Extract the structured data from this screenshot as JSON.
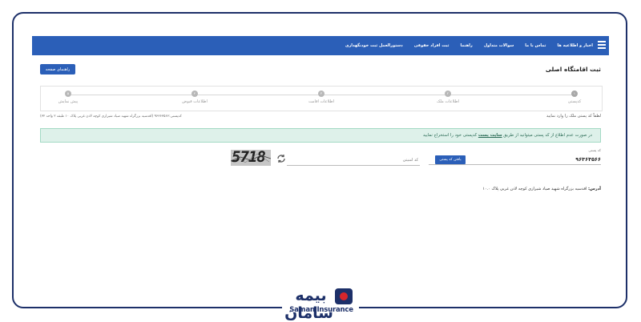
{
  "brand": {
    "name_fa": "بیمه سامان",
    "name_en": "Saman Insurance",
    "primary_color": "#1d3069",
    "accent_color": "#d6262c"
  },
  "navbar": {
    "color": "#2b5fb8",
    "menu_icon": "hamburger-menu-icon",
    "items": [
      "اخبار و اطلاعیه ها",
      "تماس با ما",
      "سوالات متداول",
      "راهنما",
      "ثبت افراد حقوقی",
      "دستورالعمل ثبت خودنگهداری"
    ]
  },
  "page": {
    "title": "ثبت اقامتگاه اصلی",
    "guide_button": "راهنمای صفحه"
  },
  "stepper": {
    "steps": [
      {
        "number": "۱",
        "label": "کدپستی"
      },
      {
        "number": "۲",
        "label": "اطلاعات ملک"
      },
      {
        "number": "۳",
        "label": "اطلاعات اقامت"
      },
      {
        "number": "۴",
        "label": "اطلاعات قبوض"
      },
      {
        "number": "۵",
        "label": "پیش نمایش"
      }
    ]
  },
  "instruction": "لطفاً کد پستی ملک را وارد نمایید",
  "owner_info": "کدپستی:۹۶۳۶۳۵۶۶ (اقدسیه بزرگراه شهید صیاد شیرازی کوچه لادن غربی پلاک ۱۰ طبقه ۲ واحد ۳۲)",
  "alert": {
    "text_before": "در صورت عدم اطلاع از کد پستی میتوانید از طریق",
    "link": "سایت پست",
    "text_after": "کدپستی خود را استخراج نمایید"
  },
  "postal_code": {
    "label": "کد پستی",
    "value": "۹۶۳۶۳۵۶۶",
    "button": "یافتن کد پستی"
  },
  "captcha": {
    "placeholder": "کد امنیتی",
    "image_text": "5718",
    "refresh_icon": "refresh-icon"
  },
  "address": {
    "label": "آدرس:",
    "value": "اقدسیه بزرگراه شهید صیاد شیرازی کوچه لادن غربی پلاک ۱۰.۰"
  }
}
